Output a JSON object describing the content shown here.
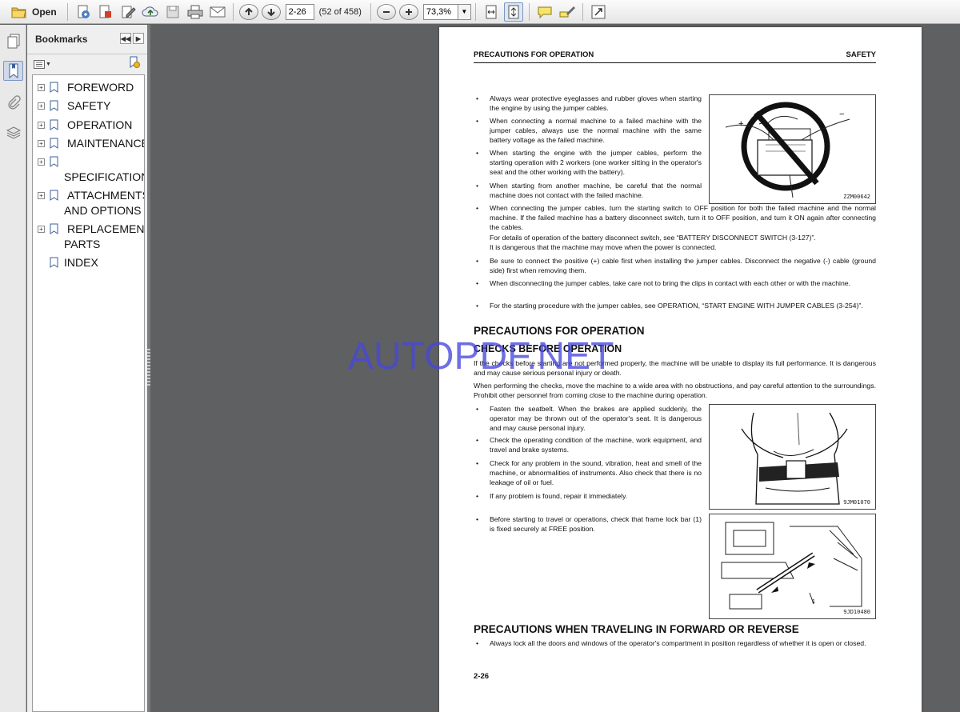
{
  "toolbar": {
    "open_label": "Open",
    "page_input_value": "2-26",
    "page_count": "(52 of 458)",
    "zoom_value": "73,3%"
  },
  "sidebar": {
    "title": "Bookmarks",
    "items": [
      {
        "label": "FOREWORD",
        "expandable": true
      },
      {
        "label": "SAFETY",
        "expandable": true
      },
      {
        "label": "OPERATION",
        "expandable": true
      },
      {
        "label": "MAINTENANCE",
        "expandable": true
      },
      {
        "label": "SPECIFICATIONS",
        "expandable": true
      },
      {
        "label": "ATTACHMENTS AND OPTIONS",
        "line1": "ATTACHMENTS",
        "line2": "AND OPTIONS",
        "expandable": true
      },
      {
        "label": "REPLACEMENT PARTS",
        "line1": "REPLACEMENT",
        "line2": "PARTS",
        "expandable": true
      },
      {
        "label": "INDEX",
        "expandable": false
      }
    ]
  },
  "document": {
    "header_left": "PRECAUTIONS FOR OPERATION",
    "header_right": "SAFETY",
    "jumper_bullets": [
      "Always wear protective eyeglasses and rubber gloves when starting the engine by using the jumper cables.",
      "When connecting a normal machine to a failed machine with the jumper cables, always use the normal machine with the same battery voltage as the failed machine.",
      "When starting the engine with the jumper cables, perform the starting operation with 2 workers (one worker sitting in the operator's seat and the other working with the battery).",
      "When starting from another machine, be careful that the normal machine does not contact with the failed machine.",
      "When connecting the jumper cables, turn the starting switch to OFF position for both the failed machine and the normal machine. If the failed machine has a battery disconnect switch, turn it to OFF position, and turn it ON again after connecting the cables.",
      "Be sure to connect the positive (+) cable first when installing the jumper cables. Disconnect the negative (-) cable (ground side) first when removing them.",
      "When disconnecting the jumper cables, take care not to bring the clips in contact with each other or with the machine.",
      "For the starting procedure with the jumper cables, see OPERATION, “START ENGINE WITH JUMPER CABLES (3-254)”."
    ],
    "bullet5_note1": "For details of operation of the battery disconnect switch, see “BATTERY DISCONNECT SWITCH (3-127)”.",
    "bullet5_note2": "It is dangerous that the machine may move when the power is connected.",
    "fig1_code": "ZZM00642",
    "fig1_plus": "+",
    "fig1_minus": "−",
    "section_title": "PRECAUTIONS FOR OPERATION",
    "subsection_title": "CHECKS BEFORE OPERATION",
    "para1": "If the checks before starting are not performed properly, the machine will be unable to display its full performance. It is dangerous and may cause serious personal injury or death.",
    "para2": "When performing the checks, move the machine to a wide area with no obstructions, and pay careful attention to the surroundings. Prohibit other personnel from coming close to the machine during operation.",
    "check_bullets": [
      "Fasten the seatbelt. When the brakes are applied suddenly, the operator may be thrown out of the operator's seat. It is dangerous and may cause personal injury.",
      "Check the operating condition of the machine, work equipment, and travel and brake systems.",
      "Check for any problem in the sound, vibration, heat and smell of the machine, or abnormalities of instruments. Also check that there is no leakage of oil or fuel.",
      "If any problem is found, repair it immediately.",
      "Before starting to travel or operations, check that frame lock bar (1) is fixed securely at FREE position."
    ],
    "fig2_code": "9JM01070",
    "fig3_code": "9JD10480",
    "fig3_callout": "1",
    "section2_title": "PRECAUTIONS WHEN TRAVELING IN FORWARD OR REVERSE",
    "travel_bullets": [
      "Always lock all the doors and windows of the operator's compartment in position regardless of whether it is open or closed."
    ],
    "page_number": "2-26"
  },
  "watermark": "AUTOPDF.NET"
}
